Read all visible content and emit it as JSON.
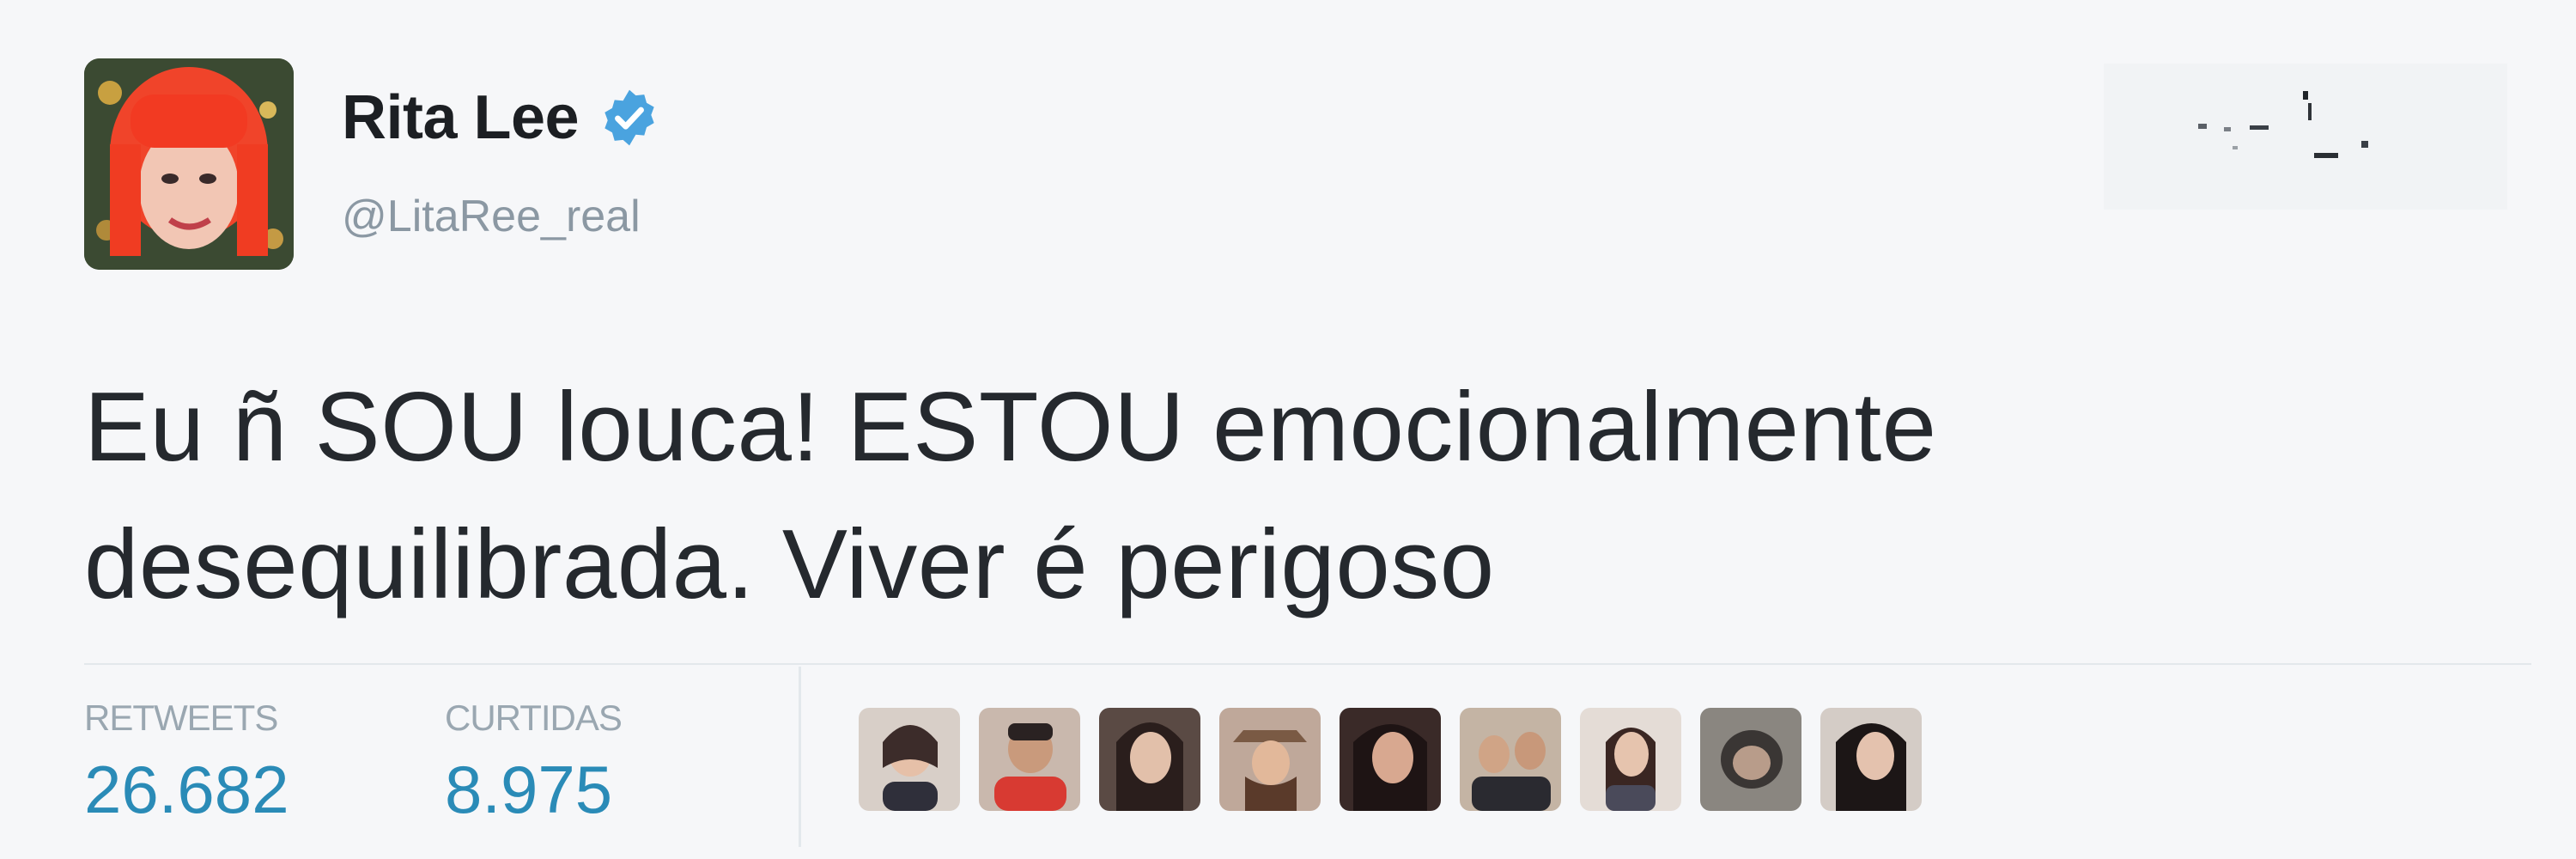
{
  "tweet": {
    "display_name": "Rita Lee",
    "handle": "@LitaRee_real",
    "text": "Eu ñ SOU louca! ESTOU emocionalmente desequilibrada. Viver é perigoso",
    "verified": true
  },
  "stats": {
    "retweets_label": "RETWEETS",
    "retweets_value": "26.682",
    "likes_label": "CURTIDAS",
    "likes_value": "8.975"
  },
  "likers": [
    {
      "icon": "liker-avatar-1"
    },
    {
      "icon": "liker-avatar-2"
    },
    {
      "icon": "liker-avatar-3"
    },
    {
      "icon": "liker-avatar-4"
    },
    {
      "icon": "liker-avatar-5"
    },
    {
      "icon": "liker-avatar-6"
    },
    {
      "icon": "liker-avatar-7"
    },
    {
      "icon": "liker-avatar-8"
    },
    {
      "icon": "liker-avatar-9"
    }
  ],
  "colors": {
    "name": "#1c1f23",
    "handle": "#8b98a3",
    "stat_value": "#2a8bb7",
    "verified": "#4aa3df"
  }
}
